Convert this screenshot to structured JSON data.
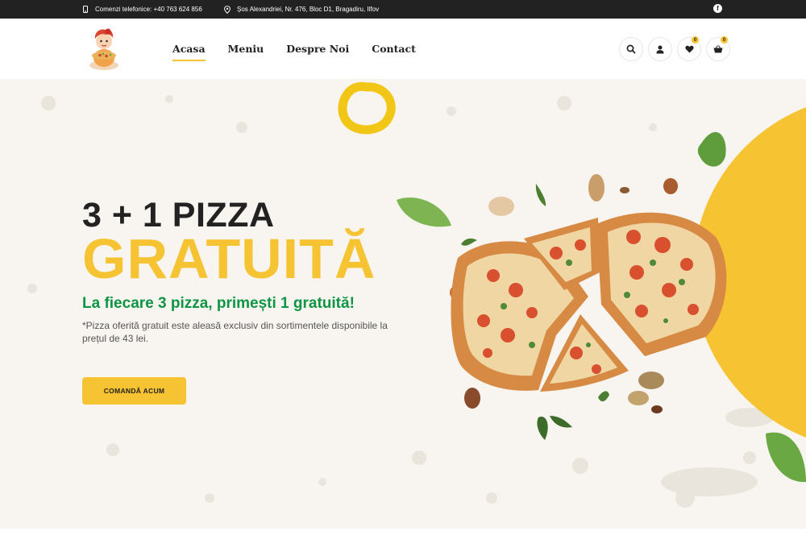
{
  "topbar": {
    "phone": "Comenzi telefonice: +40 763 624 856",
    "address": "Șos Alexandriei, Nr. 476, Bloc D1, Bragadiru, Ilfov",
    "social_icon": "facebook-icon"
  },
  "nav": {
    "items": [
      {
        "label": "Acasa",
        "active": true
      },
      {
        "label": "Meniu",
        "active": false
      },
      {
        "label": "Despre Noi",
        "active": false
      },
      {
        "label": "Contact",
        "active": false
      }
    ]
  },
  "header_actions": {
    "search_icon": "search-icon",
    "account_icon": "user-icon",
    "wishlist_icon": "heart-icon",
    "wishlist_count": "0",
    "cart_icon": "basket-icon",
    "cart_count": "0"
  },
  "hero": {
    "title_line1": "3 + 1 PIZZA",
    "title_line2": "GRATUITĂ",
    "subtitle": "La fiecare 3 pizza, primești 1 gratuită!",
    "note": "*Pizza oferită gratuit este aleasă exclusiv din sortimentele disponibile la prețul de 43 lei.",
    "cta_label": "COMANDĂ ACUM"
  },
  "colors": {
    "accent_yellow": "#f6c332",
    "green": "#0d9444",
    "dark": "#222222",
    "hero_bg": "#f8f5f0"
  }
}
